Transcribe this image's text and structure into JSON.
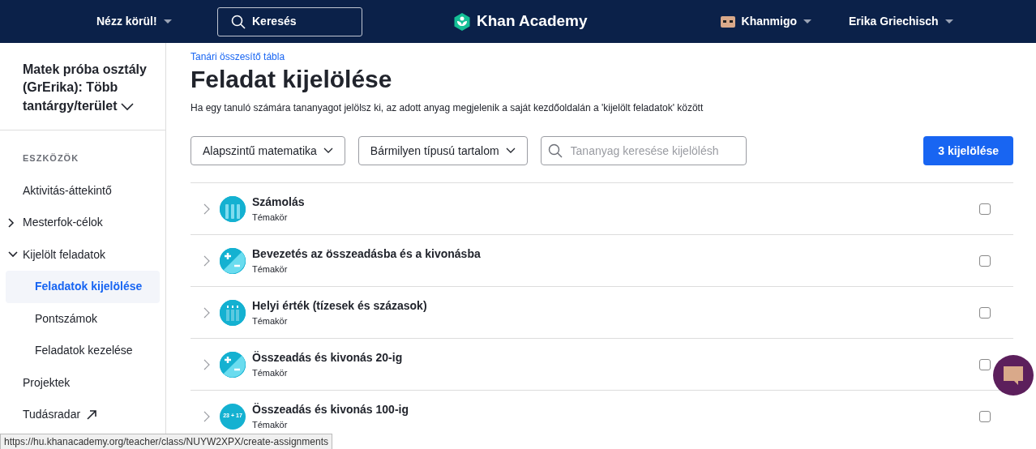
{
  "navbar": {
    "explore": "Nézz körül!",
    "search": "Keresés",
    "logo": "Khan Academy",
    "khanmigo": "Khanmigo",
    "user": "Erika Griechisch"
  },
  "sidebar": {
    "class_name": "Matek próba osztály (GrErika): Több tantárgy/terület",
    "section": "ESZKÖZÖK",
    "items": [
      {
        "label": "Aktivitás-áttekintő",
        "kind": "plain",
        "selected": false
      },
      {
        "label": "Mesterfok-célok",
        "kind": "group",
        "expanded": false,
        "selected": false
      },
      {
        "label": "Kijelölt feladatok",
        "kind": "group",
        "expanded": true,
        "selected": false,
        "children": [
          {
            "label": "Feladatok kijelölése",
            "selected": true
          },
          {
            "label": "Pontszámok",
            "selected": false
          },
          {
            "label": "Feladatok kezelése",
            "selected": false
          }
        ]
      },
      {
        "label": "Projektek",
        "kind": "plain",
        "selected": false
      },
      {
        "label": "Tudásradar",
        "kind": "external",
        "selected": false
      }
    ]
  },
  "breadcrumb": "Tanári összesítő tábla",
  "title": "Feladat kijelölése",
  "description": "Ha egy tanuló számára tananyagot jelölsz ki, az adott anyag megjelenik a saját kezdőoldalán a 'kijelölt feladatok' között",
  "filters": [
    {
      "label": "Alapszintű matematika"
    },
    {
      "label": "Bármilyen típusú tartalom"
    }
  ],
  "search": {
    "placeholder": "Tananyag keresése kijelölésh"
  },
  "assign_button": "3 kijelölése",
  "topics": [
    {
      "title": "Számolás",
      "type": "Témakör",
      "kind": "hands",
      "checked": false
    },
    {
      "title": "Bevezetés az összeadásba és a kivonásba",
      "type": "Témakör",
      "kind": "plusminus",
      "checked": false
    },
    {
      "title": "Helyi érték (tízesek és százasok)",
      "type": "Témakör",
      "kind": "columns",
      "checked": false
    },
    {
      "title": "Összeadás és kivonás 20-ig",
      "type": "Témakör",
      "kind": "plusminus",
      "checked": false
    },
    {
      "title": "Összeadás és kivonás 100-ig",
      "type": "Témakör",
      "kind": "label",
      "icon_text": "23 + 17",
      "checked": false
    }
  ],
  "status_url": "https://hu.khanacademy.org/teacher/class/NUYW2XPX/create-assignments"
}
